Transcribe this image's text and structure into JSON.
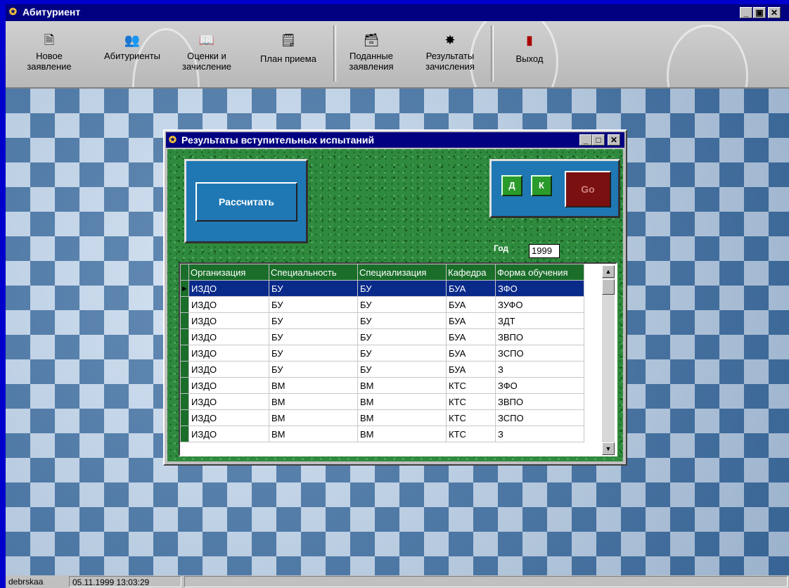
{
  "window": {
    "title": "Абитуриент"
  },
  "toolbar": {
    "items": [
      {
        "label": "Новое\nзаявление",
        "icon": "new-document-icon"
      },
      {
        "label": "Абитуриенты",
        "icon": "people-icon"
      },
      {
        "label": "Оценки и\nзачисление",
        "icon": "book-icon"
      },
      {
        "label": "План приема",
        "icon": "plan-icon"
      },
      {
        "label": "Поданные\nзаявления",
        "icon": "applications-icon"
      },
      {
        "label": "Результаты\nзачисления",
        "icon": "results-icon"
      },
      {
        "label": "Выход",
        "icon": "exit-door-icon"
      }
    ]
  },
  "dialog": {
    "title": "Результаты вступительных испытаний",
    "calc_button": "Рассчитать",
    "btn_d": "Д",
    "btn_k": "К",
    "btn_go": "Go",
    "year_label": "Год",
    "year_value": "1999",
    "table": {
      "columns": [
        "Организация",
        "Специальность",
        "Специализация",
        "Кафедра",
        "Форма обучения"
      ],
      "rows": [
        [
          "ИЗДО",
          "БУ",
          "БУ",
          "БУА",
          "ЗФО"
        ],
        [
          "ИЗДО",
          "БУ",
          "БУ",
          "БУА",
          "ЗУФО"
        ],
        [
          "ИЗДО",
          "БУ",
          "БУ",
          "БУА",
          "ЗДТ"
        ],
        [
          "ИЗДО",
          "БУ",
          "БУ",
          "БУА",
          "ЗВПО"
        ],
        [
          "ИЗДО",
          "БУ",
          "БУ",
          "БУА",
          "ЗСПО"
        ],
        [
          "ИЗДО",
          "БУ",
          "БУ",
          "БУА",
          "З"
        ],
        [
          "ИЗДО",
          "ВМ",
          "ВМ",
          "КТС",
          "ЗФО"
        ],
        [
          "ИЗДО",
          "ВМ",
          "ВМ",
          "КТС",
          "ЗВПО"
        ],
        [
          "ИЗДО",
          "ВМ",
          "ВМ",
          "КТС",
          "ЗСПО"
        ],
        [
          "ИЗДО",
          "ВМ",
          "ВМ",
          "КТС",
          "З"
        ]
      ],
      "selected_row": 0
    }
  },
  "status": {
    "user": "debrskaa",
    "datetime": "05.11.1999 13:03:29"
  },
  "colors": {
    "title_bar": "#000080",
    "grid_header": "#1a6e2a",
    "selection": "#0a2a8a",
    "go_button": "#7a1010"
  }
}
